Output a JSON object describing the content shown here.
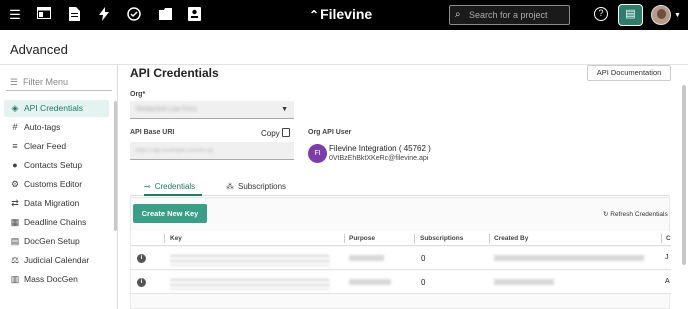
{
  "topbar": {
    "logo": "Filevine",
    "search_placeholder": "Search for a project",
    "icons": [
      "menu-icon",
      "dashboard-icon",
      "document-icon",
      "lightning-icon",
      "check-circle-icon",
      "folder-icon",
      "contacts-icon"
    ]
  },
  "page": {
    "title": "Advanced"
  },
  "sidebar": {
    "filter_placeholder": "Filter Menu",
    "items": [
      {
        "label": "API Credentials",
        "icon": "◈"
      },
      {
        "label": "Auto-tags",
        "icon": "#"
      },
      {
        "label": "Clear Feed",
        "icon": "≡"
      },
      {
        "label": "Contacts Setup",
        "icon": "●"
      },
      {
        "label": "Customs Editor",
        "icon": "⚙"
      },
      {
        "label": "Data Migration",
        "icon": "⇄"
      },
      {
        "label": "Deadline Chains",
        "icon": "▦"
      },
      {
        "label": "DocGen Setup",
        "icon": "▤"
      },
      {
        "label": "Judicial Calendar",
        "icon": "⚖"
      },
      {
        "label": "Mass DocGen",
        "icon": "▥"
      }
    ]
  },
  "main": {
    "title": "API Credentials",
    "doc_button": "API Documentation",
    "org_label": "Org*",
    "org_value": "Redacted Law Firm",
    "base_uri_label": "API Base URI",
    "copy_label": "Copy",
    "base_uri_value": "https://api.example.com/fv-sp",
    "org_user_label": "Org API User",
    "user_initials": "FI",
    "user_name": "Filevine Integration ( 45762 )",
    "user_email": "0VtBzEhBktXKeRc@filevine.api",
    "tabs": [
      {
        "label": "Credentials",
        "icon": "⊸"
      },
      {
        "label": "Subscriptions",
        "icon": "⁂"
      }
    ],
    "create_button": "Create New Key",
    "refresh_label": "Refresh Credentials",
    "columns": [
      "Key",
      "Purpose",
      "Subscriptions",
      "Created By",
      "C"
    ],
    "rows": [
      {
        "subscriptions": "0",
        "clip": "J"
      },
      {
        "subscriptions": "0",
        "clip": "A"
      }
    ]
  }
}
